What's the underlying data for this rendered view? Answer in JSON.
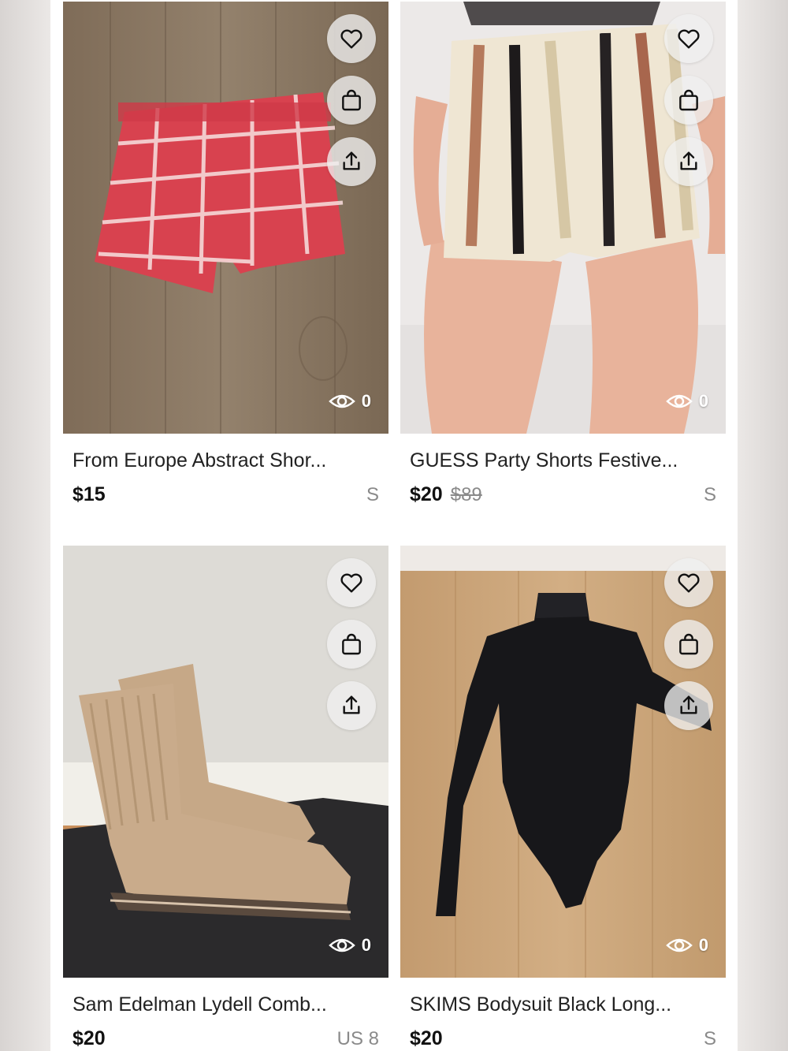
{
  "listings": [
    {
      "title": "From Europe Abstract Shor...",
      "price": "$15",
      "original_price": "",
      "size": "S",
      "views": "0",
      "actions": [
        "heart-icon",
        "shopping-bag-icon",
        "share-icon"
      ],
      "image": {
        "subject": "red plaid shorts",
        "colors": {
          "background": "#8a7862",
          "item": "#d9414f"
        }
      }
    },
    {
      "title": "GUESS Party Shorts Festive...",
      "price": "$20",
      "original_price": "$89",
      "size": "S",
      "views": "0",
      "actions": [
        "heart-icon",
        "shopping-bag-icon",
        "share-icon"
      ],
      "image": {
        "subject": "sequin striped shorts",
        "colors": {
          "background": "#eae8e7",
          "item": "#e8dcc4"
        }
      }
    },
    {
      "title": "Sam Edelman Lydell Comb...",
      "price": "$20",
      "original_price": "",
      "size": "US 8",
      "views": "0",
      "actions": [
        "heart-icon",
        "shopping-bag-icon",
        "share-icon"
      ],
      "image": {
        "subject": "tan lace-up combat boots",
        "colors": {
          "background": "#dcdad5",
          "item": "#c9ab8b"
        }
      }
    },
    {
      "title": "SKIMS Bodysuit Black Long...",
      "price": "$20",
      "original_price": "",
      "size": "S",
      "views": "0",
      "actions": [
        "heart-icon",
        "shopping-bag-icon",
        "share-icon"
      ],
      "image": {
        "subject": "black long sleeve bodysuit",
        "colors": {
          "background": "#c9a47a",
          "item": "#17171a"
        }
      }
    }
  ]
}
